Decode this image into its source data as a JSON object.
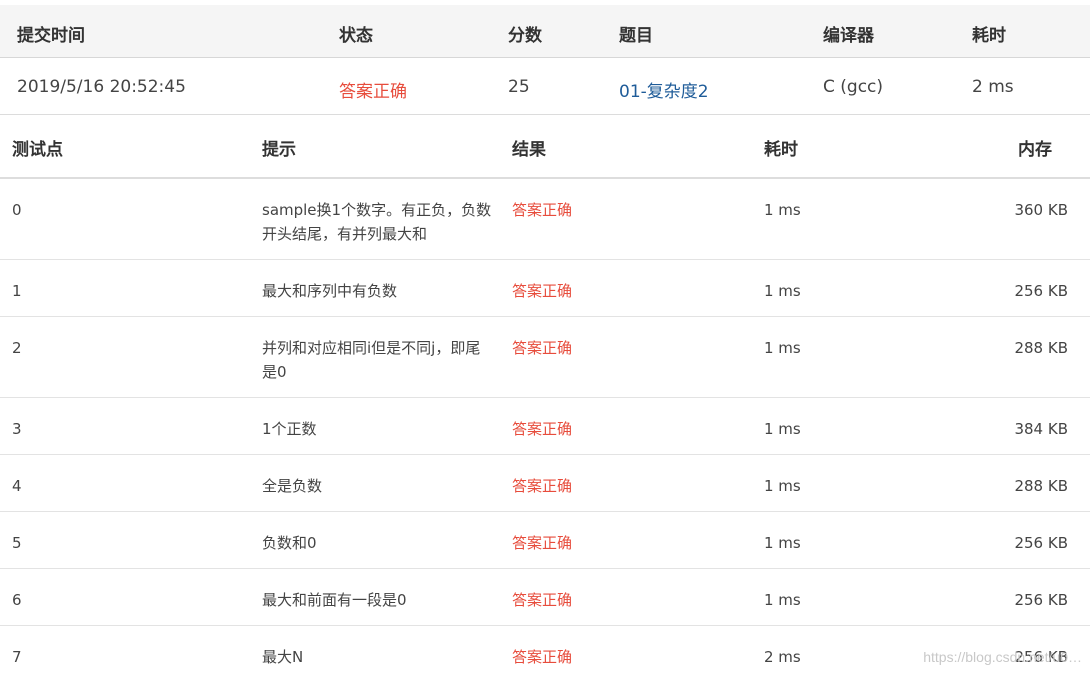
{
  "submission": {
    "headers": {
      "time": "提交时间",
      "status": "状态",
      "score": "分数",
      "problem": "题目",
      "compiler": "编译器",
      "duration": "耗时"
    },
    "row": {
      "time": "2019/5/16 20:52:45",
      "status": "答案正确",
      "score": "25",
      "problem": "01-复杂度2",
      "compiler": "C (gcc)",
      "duration": "2 ms"
    }
  },
  "cases": {
    "headers": {
      "id": "测试点",
      "hint": "提示",
      "result": "结果",
      "time": "耗时",
      "memory": "内存"
    },
    "rows": [
      {
        "id": "0",
        "hint": "sample换1个数字。有正负，负数开头结尾，有并列最大和",
        "result": "答案正确",
        "time": "1 ms",
        "memory": "360 KB"
      },
      {
        "id": "1",
        "hint": "最大和序列中有负数",
        "result": "答案正确",
        "time": "1 ms",
        "memory": "256 KB"
      },
      {
        "id": "2",
        "hint": "并列和对应相同i但是不同j，即尾是0",
        "result": "答案正确",
        "time": "1 ms",
        "memory": "288 KB"
      },
      {
        "id": "3",
        "hint": "1个正数",
        "result": "答案正确",
        "time": "1 ms",
        "memory": "384 KB"
      },
      {
        "id": "4",
        "hint": "全是负数",
        "result": "答案正确",
        "time": "1 ms",
        "memory": "288 KB"
      },
      {
        "id": "5",
        "hint": "负数和0",
        "result": "答案正确",
        "time": "1 ms",
        "memory": "256 KB"
      },
      {
        "id": "6",
        "hint": "最大和前面有一段是0",
        "result": "答案正确",
        "time": "1 ms",
        "memory": "256 KB"
      },
      {
        "id": "7",
        "hint": "最大N",
        "result": "答案正确",
        "time": "2 ms",
        "memory": "256 KB"
      }
    ]
  },
  "watermark": "https://blog.csdn.net/u0…",
  "colors": {
    "status_ok": "#e74c3c",
    "link": "#1f5c99",
    "header_bg": "#f5f5f5"
  }
}
